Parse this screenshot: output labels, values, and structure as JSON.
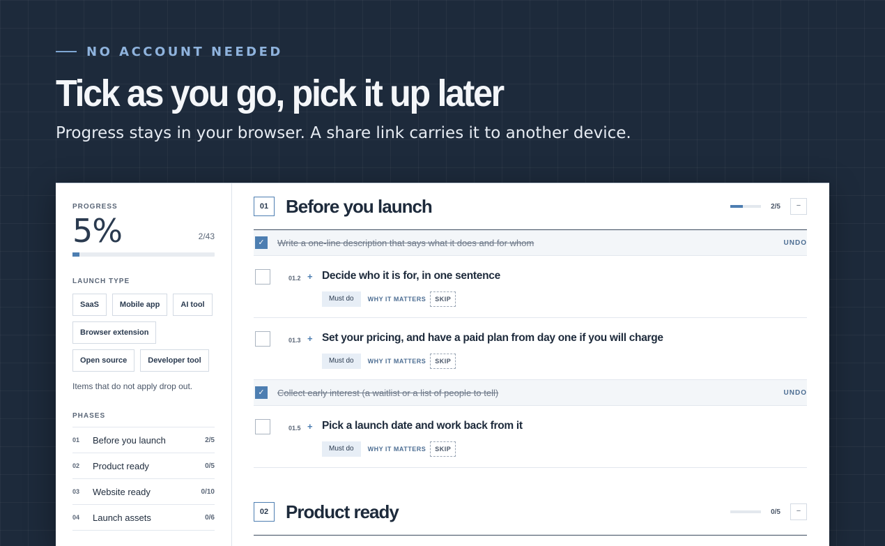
{
  "hero": {
    "eyebrow": "NO ACCOUNT NEEDED",
    "title": "Tick as you go, pick it up later",
    "subtitle": "Progress stays in your browser. A share link carries it to another device."
  },
  "sidebar": {
    "progress_label": "PROGRESS",
    "percent": "5%",
    "count": "2/43",
    "progress_fraction": 0.05,
    "launch_type_label": "LAUNCH TYPE",
    "launch_types": [
      "SaaS",
      "Mobile app",
      "AI tool",
      "Browser extension",
      "Open source",
      "Developer tool"
    ],
    "note": "Items that do not apply drop out.",
    "phases_label": "PHASES",
    "phases": [
      {
        "num": "01",
        "name": "Before you launch",
        "count": "2/5"
      },
      {
        "num": "02",
        "name": "Product ready",
        "count": "0/5"
      },
      {
        "num": "03",
        "name": "Website ready",
        "count": "0/10"
      },
      {
        "num": "04",
        "name": "Launch assets",
        "count": "0/6"
      }
    ]
  },
  "sections": [
    {
      "num": "01",
      "title": "Before you launch",
      "count": "2/5",
      "progress_fraction": 0.4,
      "collapse": "−",
      "done_items": [
        {
          "text": "Write a one-line description that says what it does and for whom",
          "undo": "UNDO"
        },
        {
          "text": "Collect early interest (a waitlist or a list of people to tell)",
          "undo": "UNDO"
        }
      ],
      "items": [
        {
          "num": "01.2",
          "plus": "+",
          "title": "Decide who it is for, in one sentence",
          "must": "Must do",
          "why": "WHY IT MATTERS",
          "skip": "SKIP"
        },
        {
          "num": "01.3",
          "plus": "+",
          "title": "Set your pricing, and have a paid plan from day one if you will charge",
          "must": "Must do",
          "why": "WHY IT MATTERS",
          "skip": "SKIP"
        },
        {
          "num": "01.5",
          "plus": "+",
          "title": "Pick a launch date and work back from it",
          "must": "Must do",
          "why": "WHY IT MATTERS",
          "skip": "SKIP"
        }
      ]
    },
    {
      "num": "02",
      "title": "Product ready",
      "count": "0/5",
      "progress_fraction": 0,
      "collapse": "−"
    }
  ],
  "icons": {
    "check": "checkmark-icon",
    "collapse": "minus-icon",
    "expand": "plus-icon"
  },
  "colors": {
    "background": "#1d2a3b",
    "accent": "#4d7eb1",
    "eyebrow": "#8fb3dd"
  }
}
